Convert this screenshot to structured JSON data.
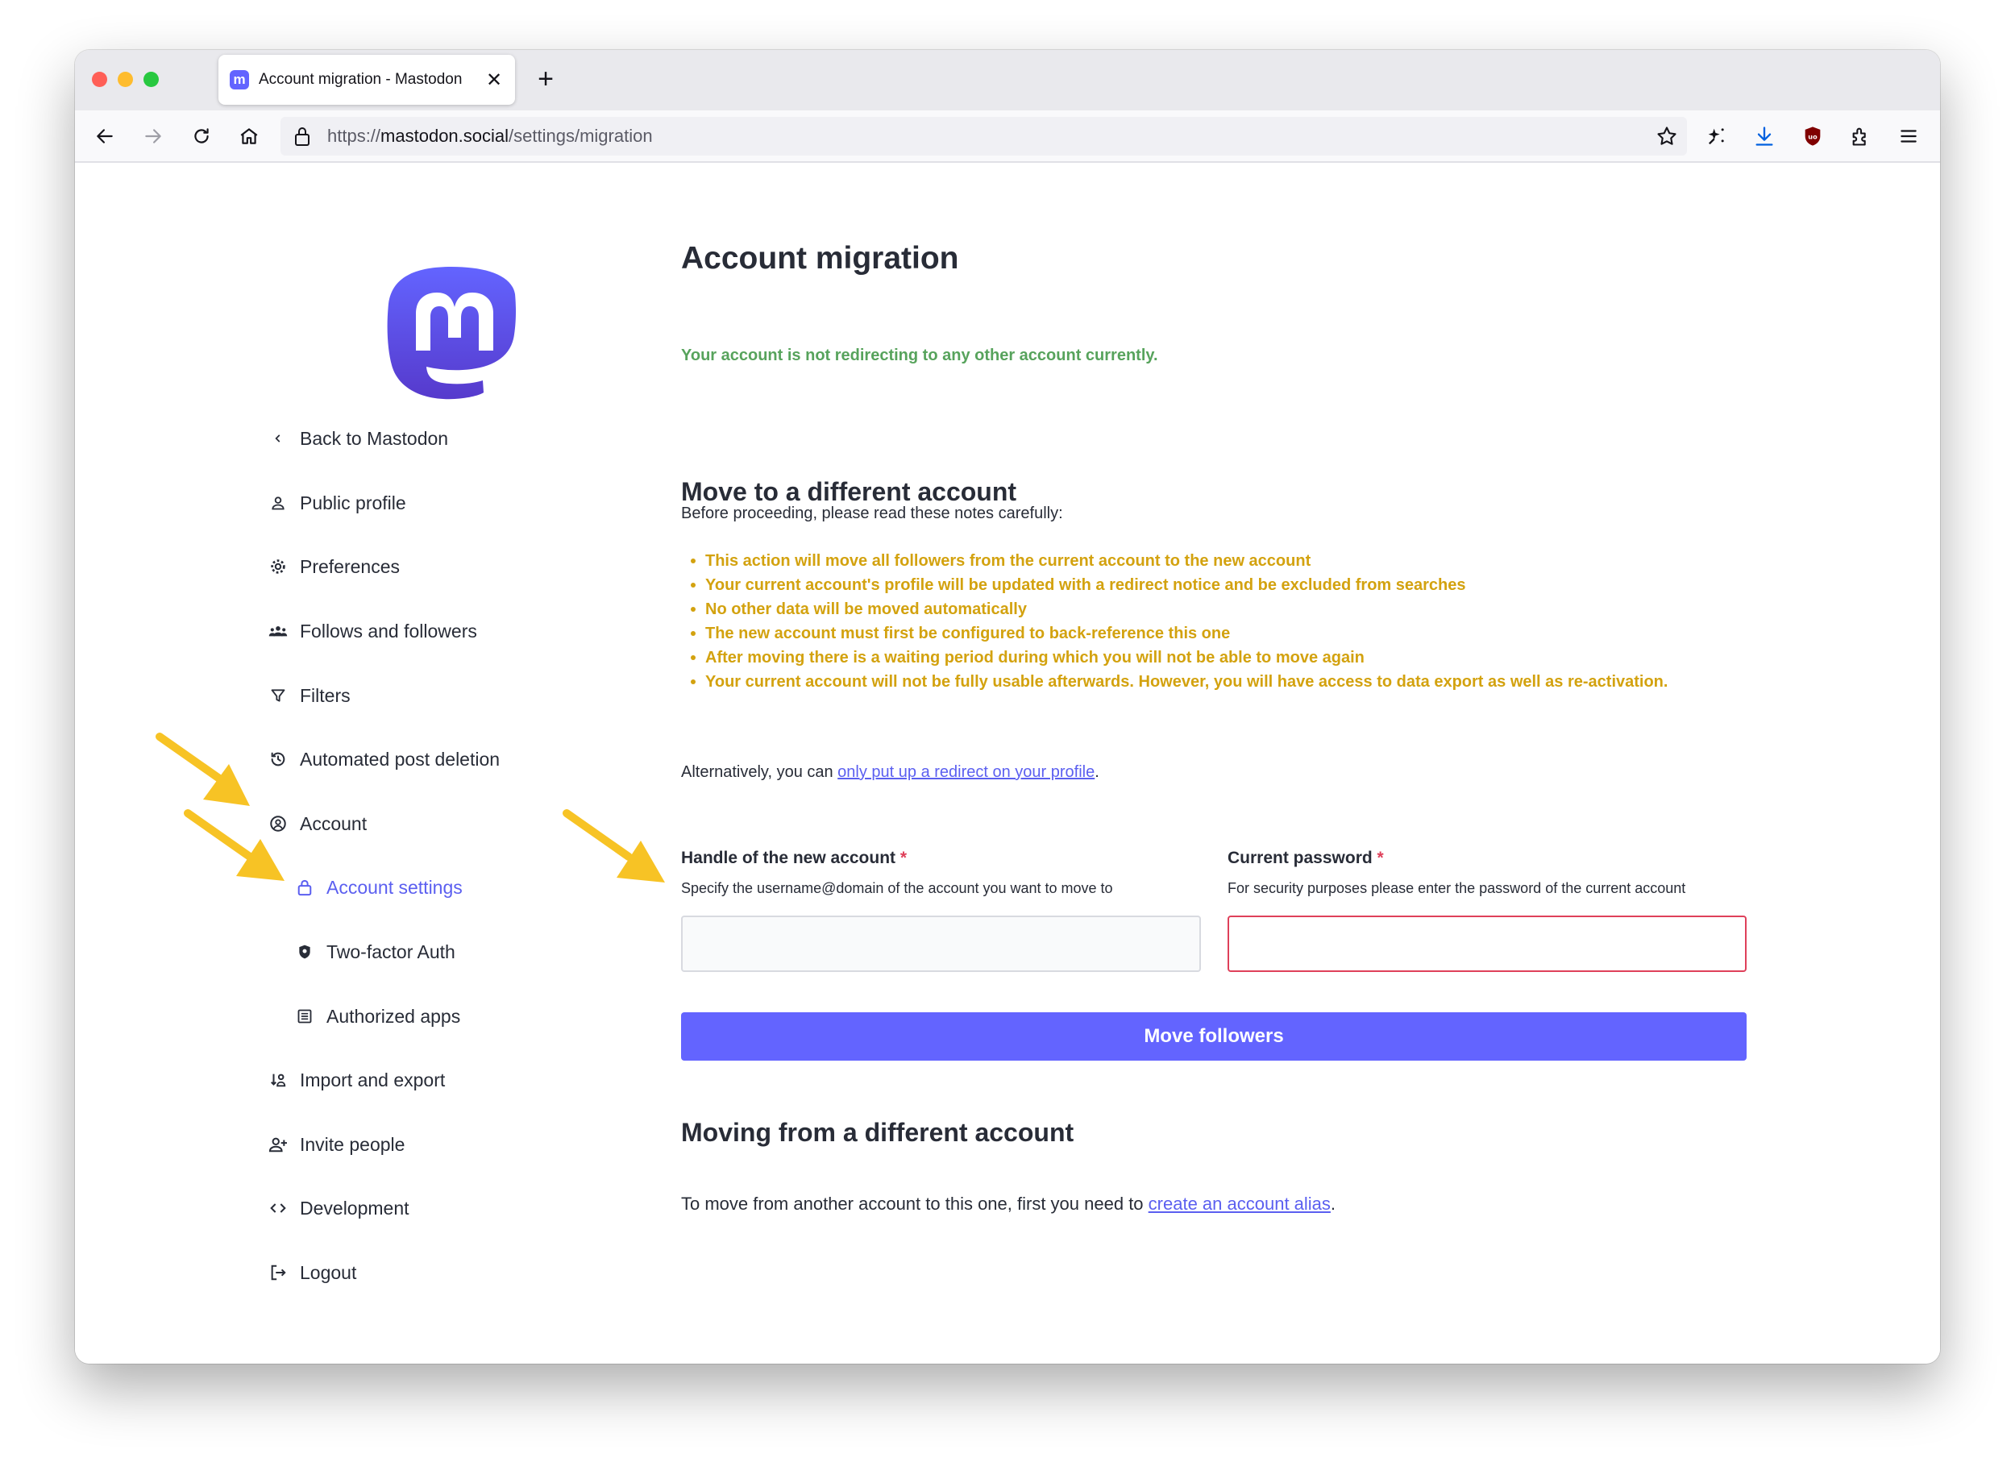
{
  "browser": {
    "tab_title": "Account migration - Mastodon",
    "tab_favicon_letter": "m",
    "url_prefix": "https://",
    "url_host": "mastodon.social",
    "url_path": "/settings/migration"
  },
  "sidebar": {
    "items": [
      {
        "label": "Back to Mastodon",
        "icon": "chevron-left-icon"
      },
      {
        "label": "Public profile",
        "icon": "person-icon"
      },
      {
        "label": "Preferences",
        "icon": "gear-icon"
      },
      {
        "label": "Follows and followers",
        "icon": "people-icon"
      },
      {
        "label": "Filters",
        "icon": "filter-icon"
      },
      {
        "label": "Automated post deletion",
        "icon": "history-icon"
      },
      {
        "label": "Account",
        "icon": "user-circle-icon"
      },
      {
        "label": "Account settings",
        "icon": "lock-icon"
      },
      {
        "label": "Two-factor Auth",
        "icon": "shield-icon"
      },
      {
        "label": "Authorized apps",
        "icon": "list-icon"
      },
      {
        "label": "Import and export",
        "icon": "import-export-icon"
      },
      {
        "label": "Invite people",
        "icon": "person-add-icon"
      },
      {
        "label": "Development",
        "icon": "code-icon"
      },
      {
        "label": "Logout",
        "icon": "logout-icon"
      }
    ]
  },
  "main": {
    "title": "Account migration",
    "status": "Your account is not redirecting to any other account currently.",
    "move_heading": "Move to a different account",
    "intro": "Before proceeding, please read these notes carefully:",
    "notes": [
      "This action will move all followers from the current account to the new account",
      "Your current account's profile will be updated with a redirect notice and be excluded from searches",
      "No other data will be moved automatically",
      "The new account must first be configured to back-reference this one",
      "After moving there is a waiting period during which you will not be able to move again",
      "Your current account will not be fully usable afterwards. However, you will have access to data export as well as re-activation."
    ],
    "alt_prefix": "Alternatively, you can ",
    "alt_link": "only put up a redirect on your profile",
    "alt_suffix": ".",
    "handle_label": "Handle of the new account",
    "handle_hint": "Specify the username@domain of the account you want to move to",
    "handle_value": "",
    "password_label": "Current password",
    "password_hint": "For security purposes please enter the password of the current account",
    "password_value": "",
    "required_mark": "*",
    "submit_label": "Move followers",
    "moving_heading": "Moving from a different account",
    "moving_prefix": "To move from another account to this one, first you need to ",
    "moving_link": "create an account alias",
    "moving_suffix": "."
  },
  "colors": {
    "brand": "#6364ff",
    "success": "#57a35c",
    "warning": "#d3a20f",
    "danger": "#df405a",
    "annotation_arrow": "#f7c325"
  }
}
